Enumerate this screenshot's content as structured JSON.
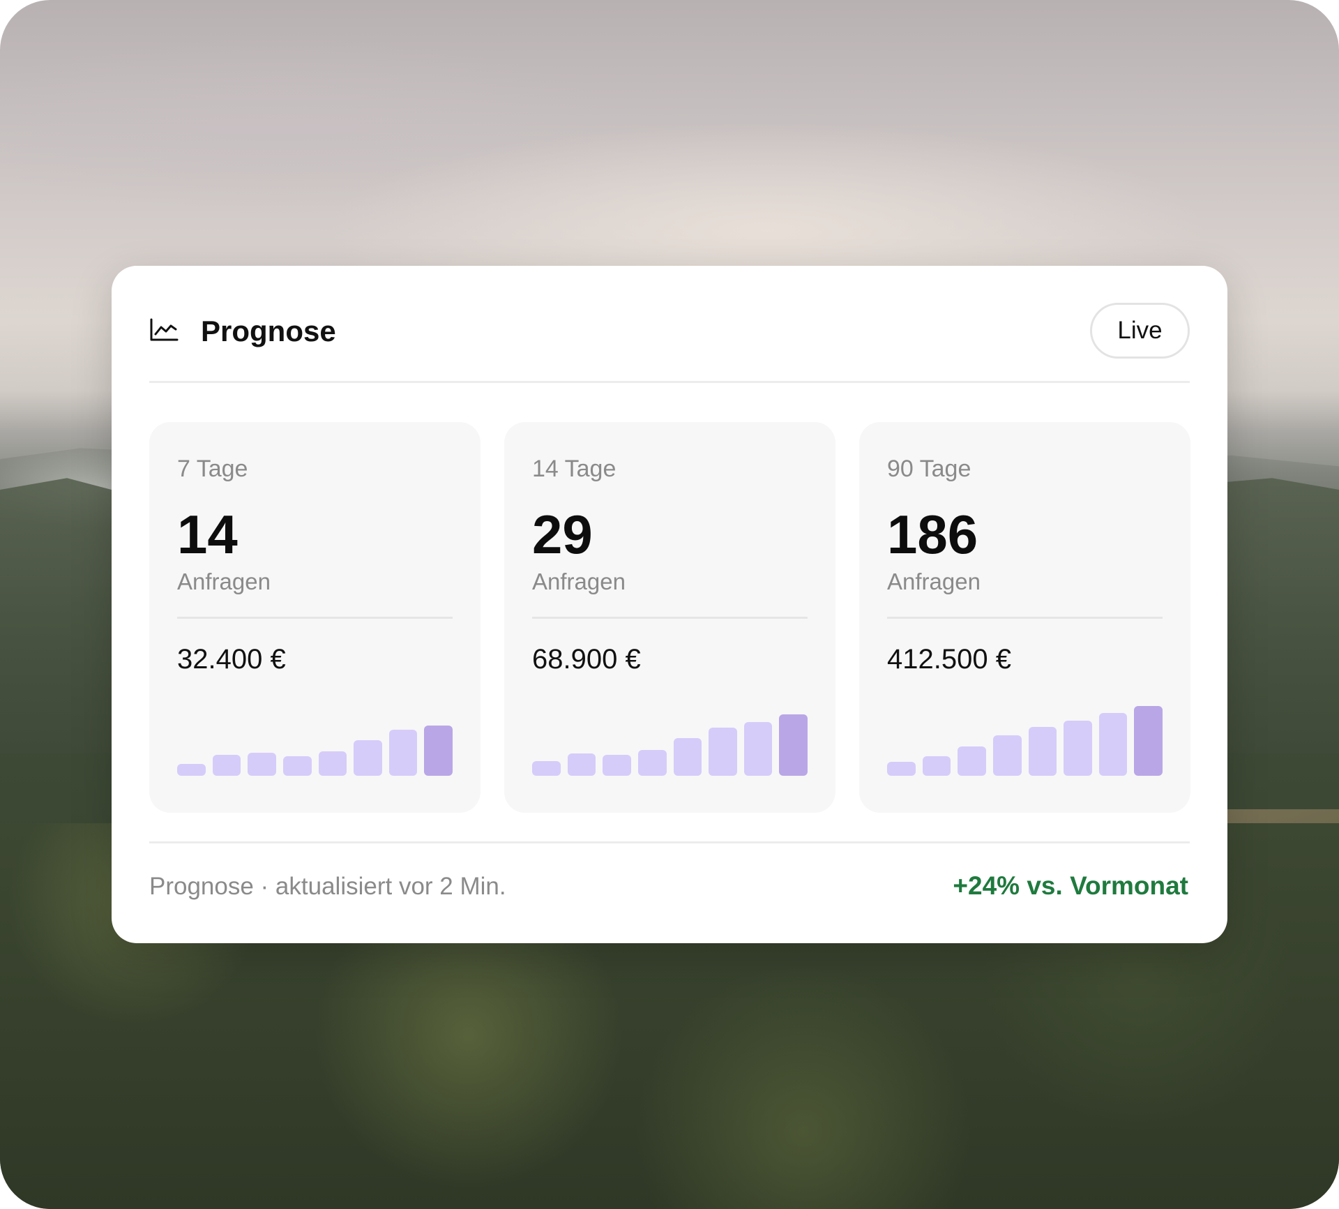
{
  "card": {
    "title": "Prognose",
    "icon": "line-chart-icon",
    "live_label": "Live"
  },
  "tiles": [
    {
      "period": "7 Tage",
      "count": "14",
      "unit": "Anfragen",
      "amount": "32.400 €",
      "bars": [
        0.15,
        0.27,
        0.3,
        0.25,
        0.32,
        0.46,
        0.6,
        0.65
      ]
    },
    {
      "period": "14 Tage",
      "count": "29",
      "unit": "Anfragen",
      "amount": "68.900 €",
      "bars": [
        0.19,
        0.29,
        0.27,
        0.34,
        0.49,
        0.63,
        0.7,
        0.8
      ]
    },
    {
      "period": "90 Tage",
      "count": "186",
      "unit": "Anfragen",
      "amount": "412.500 €",
      "bars": [
        0.18,
        0.25,
        0.38,
        0.53,
        0.64,
        0.72,
        0.82,
        0.91
      ]
    }
  ],
  "footer": {
    "status": "Prognose · aktualisiert vor 2 Min.",
    "trend": "+24% vs. Vormonat"
  },
  "colors": {
    "bar": "#d6ccfa",
    "bar_highlight": "#b9a6e6",
    "trend": "#1f7a3e"
  }
}
